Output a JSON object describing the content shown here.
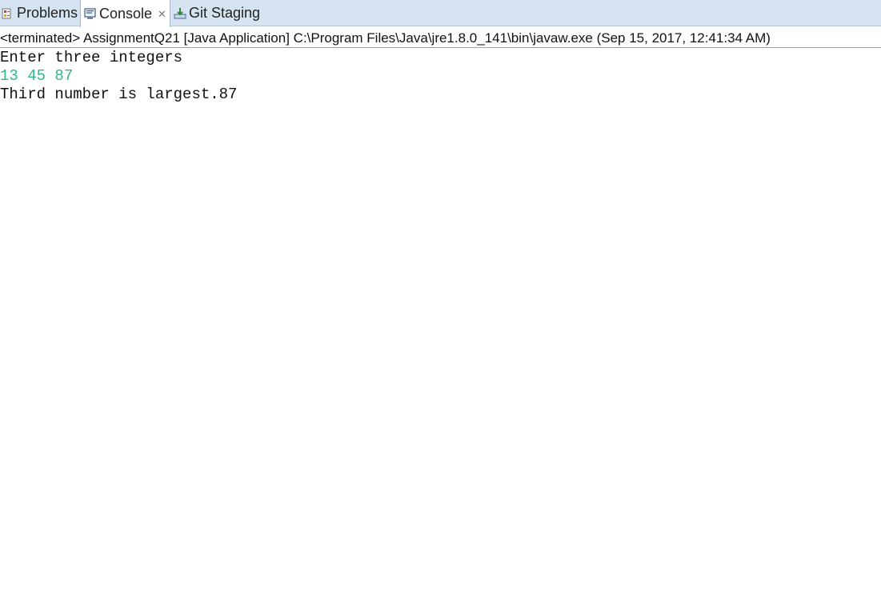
{
  "tabs": {
    "problems": {
      "label": "Problems",
      "icon": "problems-icon"
    },
    "console": {
      "label": "Console",
      "icon": "console-icon",
      "close": "✕",
      "active": true
    },
    "git": {
      "label": "Git Staging",
      "icon": "git-staging-icon"
    }
  },
  "status": {
    "text": "<terminated> AssignmentQ21 [Java Application] C:\\Program Files\\Java\\jre1.8.0_141\\bin\\javaw.exe (Sep 15, 2017, 12:41:34 AM)"
  },
  "console": {
    "lines": [
      {
        "text": "Enter three integers",
        "kind": "out"
      },
      {
        "text": "13 45 87",
        "kind": "in"
      },
      {
        "text": "Third number is largest.87",
        "kind": "out"
      }
    ]
  },
  "colors": {
    "tabbar_bg": "#d6e4f2",
    "user_input": "#2eb888",
    "output_text": "#111111"
  }
}
